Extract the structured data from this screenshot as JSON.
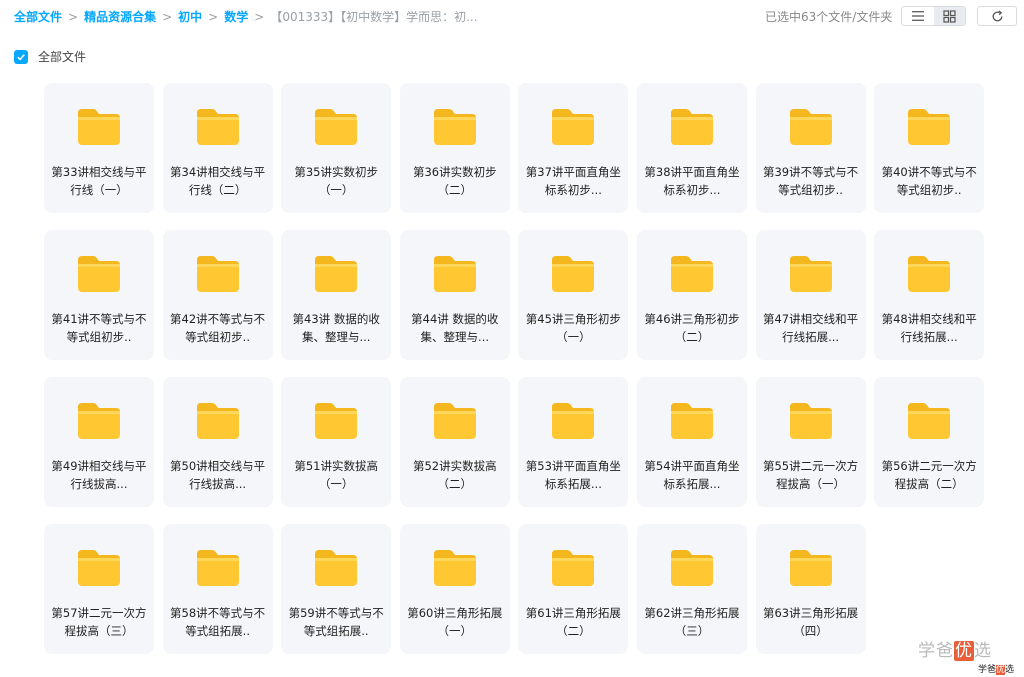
{
  "breadcrumb": {
    "items": [
      "全部文件",
      "精品资源合集",
      "初中",
      "数学"
    ],
    "current": "【001333】【初中数学】学而思：初..."
  },
  "toolbar": {
    "selection_info": "已选中63个文件/文件夹"
  },
  "select_all": {
    "checked": true,
    "label": "全部文件"
  },
  "folders": [
    "第33讲相交线与平行线（一）",
    "第34讲相交线与平行线（二）",
    "第35讲实数初步（一）",
    "第36讲实数初步（二）",
    "第37讲平面直角坐标系初步...",
    "第38讲平面直角坐标系初步...",
    "第39讲不等式与不等式组初步..",
    "第40讲不等式与不等式组初步..",
    "第41讲不等式与不等式组初步..",
    "第42讲不等式与不等式组初步..",
    "第43讲 数据的收集、整理与...",
    "第44讲 数据的收集、整理与...",
    "第45讲三角形初步（一）",
    "第46讲三角形初步（二）",
    "第47讲相交线和平行线拓展...",
    "第48讲相交线和平行线拓展...",
    "第49讲相交线与平行线拔高...",
    "第50讲相交线与平行线拔高...",
    "第51讲实数拔高（一）",
    "第52讲实数拔高（二）",
    "第53讲平面直角坐标系拓展...",
    "第54讲平面直角坐标系拓展...",
    "第55讲二元一次方程拔高（一）",
    "第56讲二元一次方程拔高（二）",
    "第57讲二元一次方程拔高（三）",
    "第58讲不等式与不等式组拓展..",
    "第59讲不等式与不等式组拓展..",
    "第60讲三角形拓展（一）",
    "第61讲三角形拓展（二）",
    "第62讲三角形拓展（三）",
    "第63讲三角形拓展（四）"
  ],
  "watermark": {
    "large_pre": "学爸",
    "large_hl": "优",
    "large_post": "选",
    "small_pre": "学爸",
    "small_hl": "优",
    "small_post": "选"
  },
  "colors": {
    "accent": "#06a7ff",
    "folder": "#ffc832",
    "tile_bg": "#f5f6f9"
  }
}
